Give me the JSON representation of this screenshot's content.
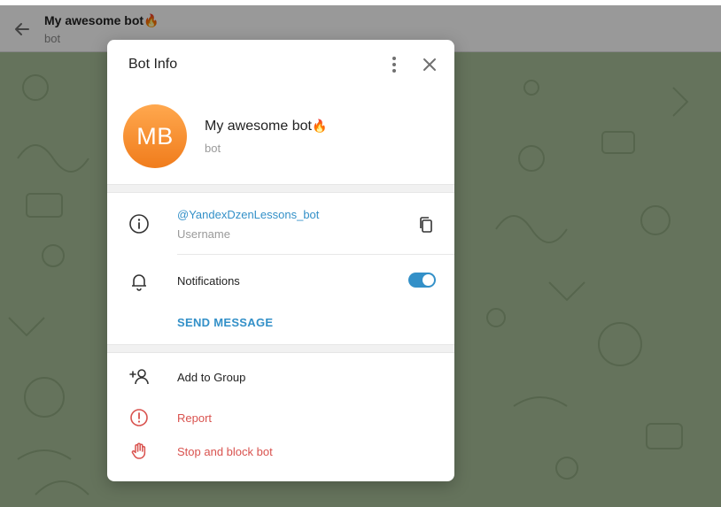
{
  "chat_header": {
    "title": "My awesome bot",
    "title_emoji": "🔥",
    "subtitle": "bot"
  },
  "modal": {
    "title": "Bot Info",
    "avatar_initials": "MB",
    "avatar_color_top": "#ffa84e",
    "avatar_color_bottom": "#f07c1c",
    "bot_name": "My awesome bot",
    "bot_emoji": "🔥",
    "bot_subtitle": "bot",
    "username": "@YandexDzenLessons_bot",
    "username_label": "Username",
    "notifications_label": "Notifications",
    "notifications_enabled": true,
    "send_message": "SEND MESSAGE",
    "add_to_group": "Add to Group",
    "report": "Report",
    "stop_block": "Stop and block bot"
  },
  "icons": {
    "back": "arrow-left-icon",
    "more": "more-vertical-icon",
    "close": "close-icon",
    "info": "info-icon",
    "copy": "copy-icon",
    "bell": "bell-icon",
    "add_user": "add-user-icon",
    "report": "report-icon",
    "stop": "hand-stop-icon"
  },
  "colors": {
    "accent": "#3390c8",
    "danger": "#d9534f",
    "wallpaper": "#a9c09a"
  }
}
